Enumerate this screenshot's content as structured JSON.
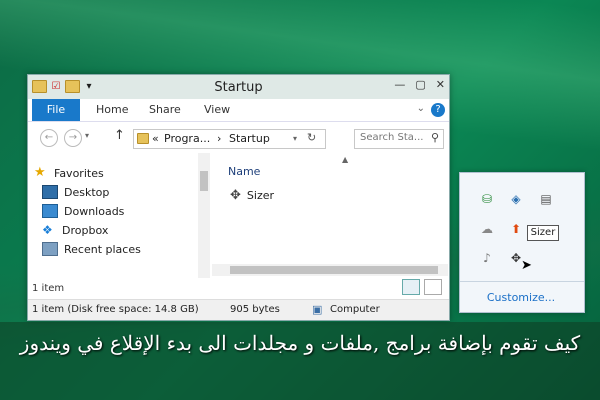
{
  "window": {
    "title": "Startup",
    "ribbon": {
      "file": "File",
      "home": "Home",
      "share": "Share",
      "view": "View",
      "help": "?"
    },
    "address": {
      "prefix": "«",
      "crumb1": "Progra...",
      "separator": "›",
      "crumb2": "Startup"
    },
    "search_placeholder": "Search Sta...",
    "nav_pane": [
      {
        "label": "Favorites"
      },
      {
        "label": "Desktop"
      },
      {
        "label": "Downloads"
      },
      {
        "label": "Dropbox"
      },
      {
        "label": "Recent places"
      }
    ],
    "column_header": "Name",
    "file_item": "Sizer",
    "item_count": "1 item",
    "status": {
      "left": "1 item (Disk free space: 14.8 GB)",
      "size": "905 bytes",
      "location": "Computer"
    }
  },
  "tray": {
    "tooltip": "Sizer",
    "customize": "Customize..."
  },
  "caption": "كيف تقوم بإضافة برامج ,ملفات و مجلدات الى بدء الإقلاع في ويندوز"
}
